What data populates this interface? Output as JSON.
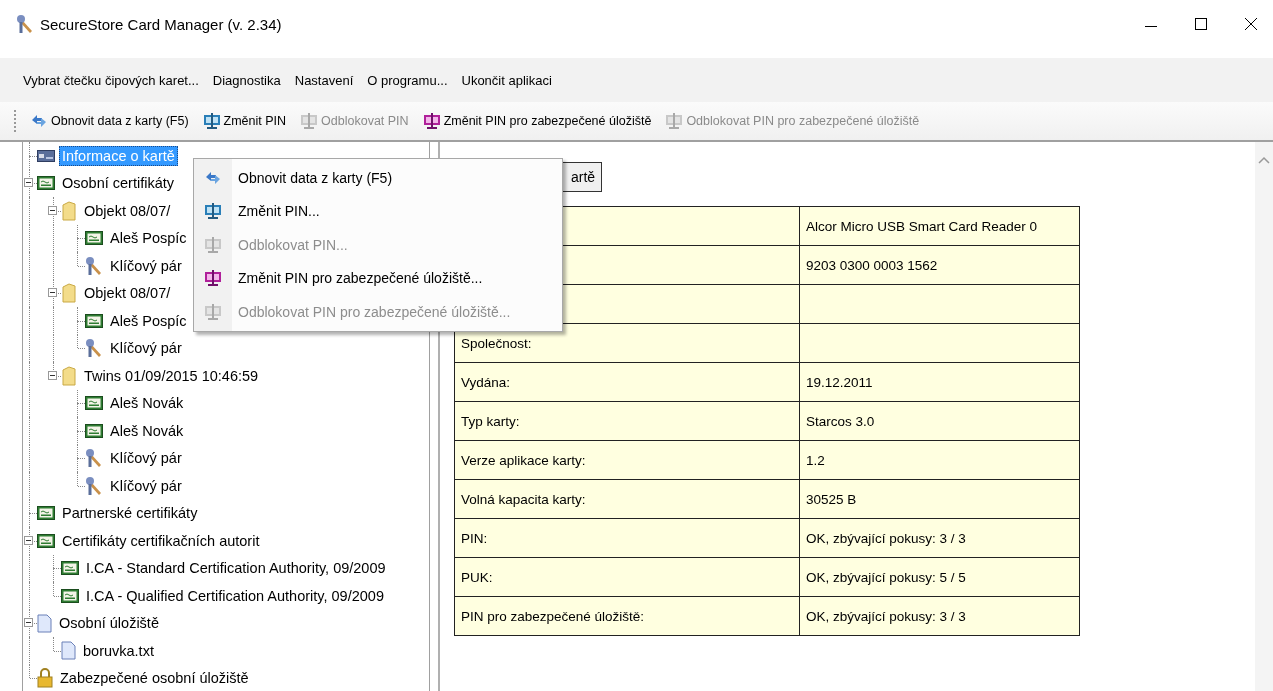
{
  "window": {
    "title": "SecureStore Card Manager (v. 2.34)"
  },
  "menu_bar": [
    "Vybrat čtečku čipových karet...",
    "Diagnostika",
    "Nastavení",
    "O programu...",
    "Ukončit aplikaci"
  ],
  "toolbar": [
    {
      "kind": "refresh",
      "label": "Obnovit data z karty (F5)",
      "disabled": false
    },
    {
      "kind": "pin",
      "label": "Změnit PIN",
      "disabled": false
    },
    {
      "kind": "pin",
      "label": "Odblokovat PIN",
      "disabled": true
    },
    {
      "kind": "secure-pin",
      "label": "Změnit PIN pro zabezpečené úložiště",
      "disabled": false
    },
    {
      "kind": "secure-pin",
      "label": "Odblokovat PIN pro zabezpečené úložiště",
      "disabled": true
    }
  ],
  "tree": [
    {
      "kind": "card",
      "label": "Informace o kartě",
      "selected": true
    },
    {
      "kind": "cert",
      "label": "Osobní certifikáty",
      "selected": false,
      "expanded": true,
      "children": [
        {
          "kind": "folder",
          "label": "Objekt 08/07/",
          "selected": false,
          "expanded": true,
          "children": [
            {
              "kind": "cert",
              "label": "Aleš Pospíc",
              "selected": false
            },
            {
              "kind": "key",
              "label": "Klíčový pár",
              "selected": false
            }
          ]
        },
        {
          "kind": "folder",
          "label": "Objekt 08/07/",
          "selected": false,
          "expanded": true,
          "children": [
            {
              "kind": "cert",
              "label": "Aleš Pospíc",
              "selected": false
            },
            {
              "kind": "key",
              "label": "Klíčový pár",
              "selected": false
            }
          ]
        },
        {
          "kind": "folder",
          "label": "Twins 01/09/2015 10:46:59",
          "selected": false,
          "expanded": true,
          "children": [
            {
              "kind": "cert",
              "label": "Aleš Novák",
              "selected": false
            },
            {
              "kind": "cert",
              "label": "Aleš Novák",
              "selected": false
            },
            {
              "kind": "key",
              "label": "Klíčový pár",
              "selected": false
            },
            {
              "kind": "key",
              "label": "Klíčový pár",
              "selected": false
            }
          ]
        }
      ]
    },
    {
      "kind": "cert",
      "label": "Partnerské certifikáty",
      "selected": false
    },
    {
      "kind": "cert",
      "label": "Certifikáty certifikačních autorit",
      "selected": false,
      "expanded": true,
      "children": [
        {
          "kind": "cert",
          "label": "I.CA - Standard Certification Authority, 09/2009",
          "selected": false
        },
        {
          "kind": "cert",
          "label": "I.CA - Qualified Certification Authority, 09/2009",
          "selected": false
        }
      ]
    },
    {
      "kind": "document",
      "label": "Osobní úložiště",
      "selected": false,
      "expanded": true,
      "children": [
        {
          "kind": "document",
          "label": "boruvka.txt",
          "selected": false
        }
      ]
    },
    {
      "kind": "lock",
      "label": "Zabezpečené osobní úložiště",
      "selected": false
    }
  ],
  "info_panel": {
    "button": {
      "label": "artě"
    },
    "table": {
      "rows": [
        {
          "value": "Alcor Micro USB Smart Card Reader 0"
        },
        {
          "value": "9203 0300 0003 1562"
        },
        {},
        {
          "label": "Společnost:"
        },
        {
          "label": "Vydána:",
          "value": "19.12.2011"
        },
        {
          "label": "Typ karty:",
          "value": "Starcos 3.0"
        },
        {
          "label": "Verze aplikace karty:",
          "value": "1.2"
        },
        {
          "label": "Volná kapacita karty:",
          "value": "30525 B"
        },
        {
          "label": "PIN:",
          "value": "OK, zbývající pokusy: 3 / 3"
        },
        {
          "label": "PUK:",
          "value": "OK, zbývající pokusy: 5 / 5"
        },
        {
          "label": "PIN pro zabezpečené úložiště:",
          "value": "OK, zbývající pokusy: 3 / 3"
        }
      ]
    }
  },
  "context_menu": [
    {
      "kind": "refresh",
      "label": "Obnovit data z karty (F5)",
      "disabled": false
    },
    {
      "kind": "pin",
      "label": "Změnit PIN...",
      "disabled": false
    },
    {
      "kind": "pin",
      "label": "Odblokovat PIN...",
      "disabled": true
    },
    {
      "kind": "secure-pin",
      "label": "Změnit PIN pro zabezpečené úložiště...",
      "disabled": false
    },
    {
      "kind": "pin",
      "label": "Odblokovat PIN pro zabezpečené úložiště...",
      "disabled": true
    }
  ]
}
